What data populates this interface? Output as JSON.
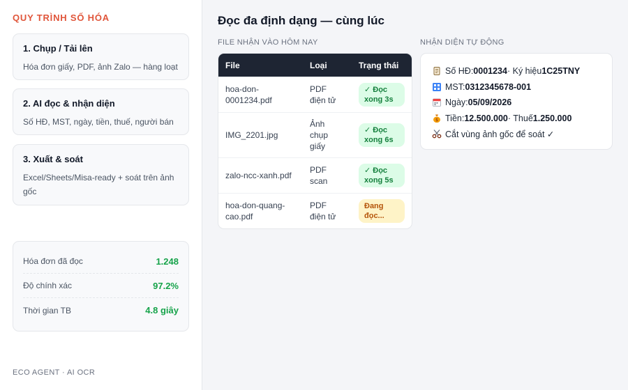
{
  "sidebar": {
    "brand": "QUY TRÌNH SỐ HÓA",
    "steps": [
      {
        "title": "1. Chụp / Tải lên",
        "desc": "Hóa đơn giấy, PDF, ảnh Zalo — hàng loạt"
      },
      {
        "title": "2. AI đọc & nhận diện",
        "desc": "Số HĐ, MST, ngày, tiền, thuế, người bán"
      },
      {
        "title": "3. Xuất & soát",
        "desc": "Excel/Sheets/Misa-ready + soát trên ảnh gốc"
      }
    ],
    "stats": [
      {
        "label": "Hóa đơn đã đọc",
        "value": "1.248"
      },
      {
        "label": "Độ chính xác",
        "value": "97.2%"
      },
      {
        "label": "Thời gian TB",
        "value": "4.8 giây"
      }
    ],
    "footer": "ECO AGENT · AI OCR"
  },
  "main": {
    "title": "Đọc đa định dạng — cùng lúc",
    "files_label": "FILE NHẬN VÀO HÔM NAY",
    "detect_label": "NHẬN DIỆN TỰ ĐỘNG",
    "table": {
      "headers": [
        "File",
        "Loại",
        "Trạng thái"
      ],
      "rows": [
        {
          "file": "hoa-don-0001234.pdf",
          "type": "PDF điện tử",
          "status": "✓ Đọc xong 3s",
          "state": "done"
        },
        {
          "file": "IMG_2201.jpg",
          "type": "Ảnh chụp giấy",
          "status": "✓ Đọc xong 6s",
          "state": "done"
        },
        {
          "file": "zalo-ncc-xanh.pdf",
          "type": "PDF scan",
          "status": "✓ Đọc xong 5s",
          "state": "done"
        },
        {
          "file": "hoa-don-quang-cao.pdf",
          "type": "PDF điện tử",
          "status": "Đang đọc...",
          "state": "pending"
        }
      ]
    },
    "detect": {
      "invoice_label": "Số HĐ: ",
      "invoice_no": "0001234",
      "symbol_label": " · Ký hiệu ",
      "symbol": "1C25TNY",
      "mst_label": "MST: ",
      "mst": "0312345678-001",
      "date_label": "Ngày: ",
      "date": "05/09/2026",
      "amount_label": "Tiền: ",
      "amount": "12.500.000",
      "tax_label": " · Thuế ",
      "tax": "1.250.000",
      "crop_text": "Cắt vùng ảnh gốc để soát ✓"
    }
  },
  "colors": {
    "brand": "#e0553a",
    "table_header_bg": "#1e2533",
    "stat_value": "#16a34a",
    "badge_done_bg": "#dcfce7",
    "badge_done_text": "#15803d",
    "badge_pending_bg": "#fef3c7",
    "badge_pending_text": "#b45309"
  },
  "icons": [
    "scroll-icon",
    "id-card-icon",
    "calendar-icon",
    "money-bag-icon",
    "scissors-icon"
  ]
}
